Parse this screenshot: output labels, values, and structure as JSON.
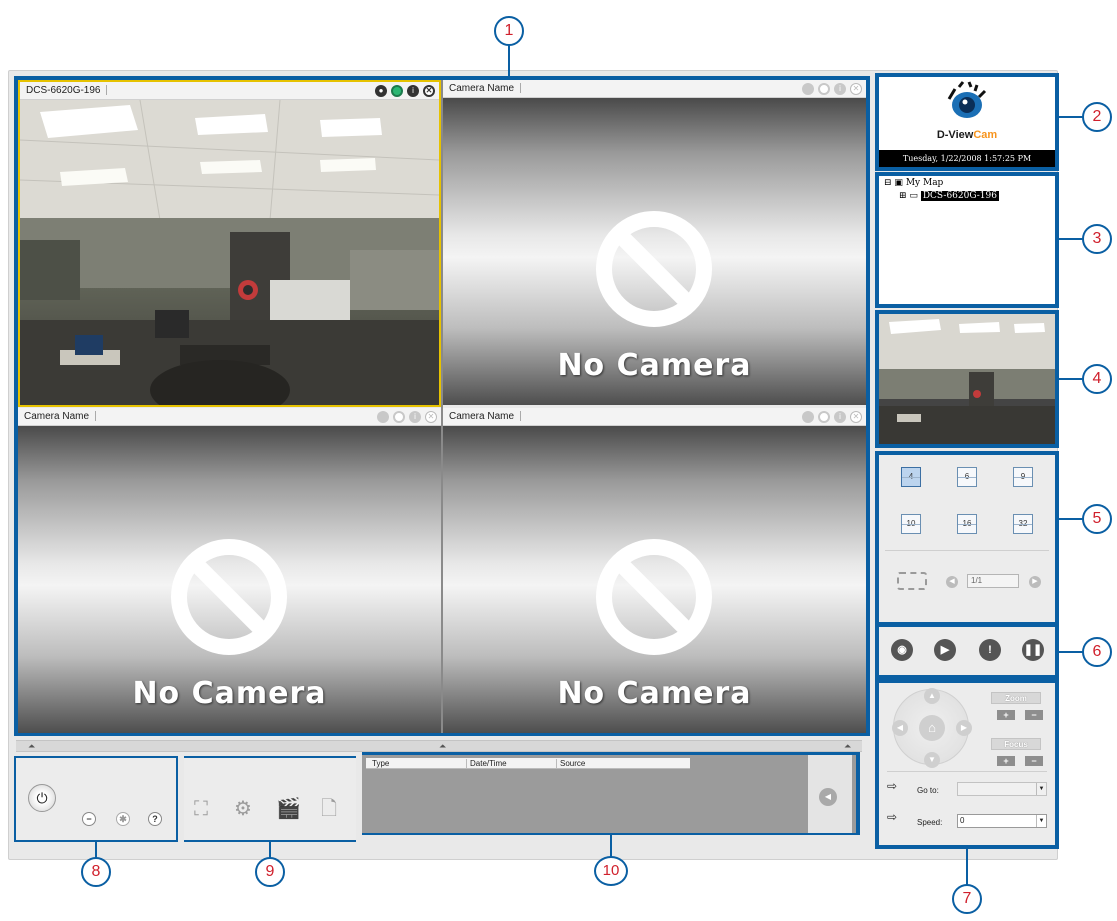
{
  "app": {
    "logo": {
      "brand": "D-View",
      "brand_accent": "Cam",
      "accent_color": "#f7941d"
    },
    "datetime": "Tuesday, 1/22/2008 1:57:25 PM"
  },
  "cameras": [
    {
      "name": "DCS-6620G-196",
      "status": "live"
    },
    {
      "name": "Camera Name",
      "status": "No Camera"
    },
    {
      "name": "Camera Name",
      "status": "No Camera"
    },
    {
      "name": "Camera Name",
      "status": "No Camera"
    }
  ],
  "tree": {
    "root": "My Map",
    "device": "DCS-6620G-196"
  },
  "layouts": [
    "4",
    "6",
    "9",
    "10",
    "16",
    "32"
  ],
  "paging": {
    "page": "1/1"
  },
  "ptz": {
    "zoom_label": "Zoom",
    "focus_label": "Focus",
    "plus": "+",
    "minus": "−",
    "goto_label": "Go to:",
    "goto_value": "",
    "speed_label": "Speed:",
    "speed_value": "0"
  },
  "log": {
    "columns": [
      "Type",
      "Date/Time",
      "Source"
    ]
  },
  "controls": {
    "help": "?"
  },
  "callouts": [
    "1",
    "2",
    "3",
    "4",
    "5",
    "6",
    "7",
    "8",
    "9",
    "10"
  ],
  "colors": {
    "frame_blue": "#0a5fa3",
    "callout_text": "#d0202c",
    "selected_border": "#e6c200"
  }
}
